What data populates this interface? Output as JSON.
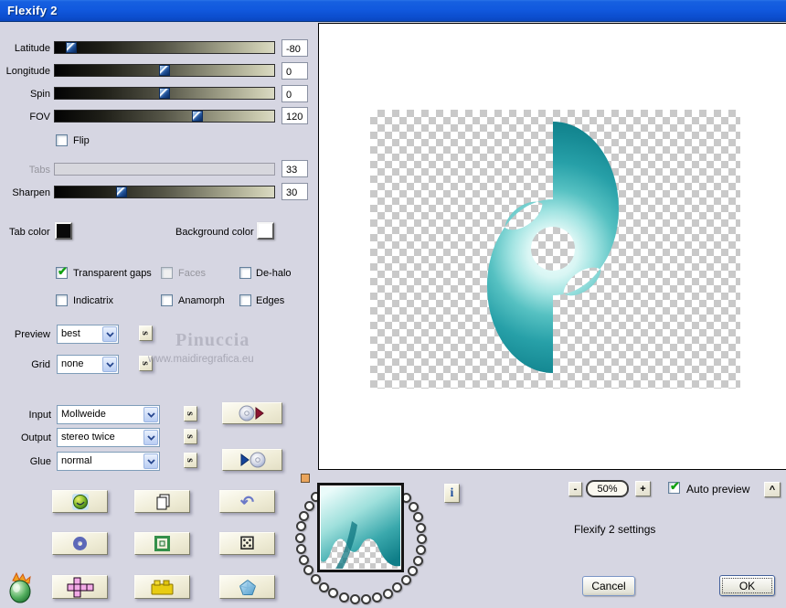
{
  "window": {
    "title": "Flexify 2"
  },
  "colors": {
    "titlebar_blue": "#1159de",
    "dialog_bg": "#d6d6e2",
    "button_beige": "#efecd6",
    "teal_dark": "#107e88",
    "teal_light": "#eafbfa",
    "check_green": "#12a112",
    "tab_color_swatch": "#0a0a0a",
    "background_color_swatch": "#ffffff"
  },
  "sliders": [
    {
      "label": "Latitude",
      "value": "-80",
      "percent": 7.6,
      "disabled": false
    },
    {
      "label": "Longitude",
      "value": "0",
      "percent": 49.8,
      "disabled": false
    },
    {
      "label": "Spin",
      "value": "0",
      "percent": 49.8,
      "disabled": false
    },
    {
      "label": "FOV",
      "value": "120",
      "percent": 65.1,
      "disabled": false
    },
    {
      "label": "Tabs",
      "value": "33",
      "percent": null,
      "disabled": true
    },
    {
      "label": "Sharpen",
      "value": "30",
      "percent": 30.6,
      "disabled": false
    }
  ],
  "flip": {
    "label": "Flip",
    "checked": false
  },
  "color_row": {
    "tab_color_label": "Tab color",
    "background_color_label": "Background color"
  },
  "option_checkboxes": [
    {
      "label": "Transparent gaps",
      "checked": true,
      "disabled": false
    },
    {
      "label": "Faces",
      "checked": false,
      "disabled": true
    },
    {
      "label": "De-halo",
      "checked": false,
      "disabled": false
    },
    {
      "label": "Indicatrix",
      "checked": false,
      "disabled": false
    },
    {
      "label": "Anamorph",
      "checked": false,
      "disabled": false
    },
    {
      "label": "Edges",
      "checked": false,
      "disabled": false
    }
  ],
  "selects": {
    "preview": {
      "label": "Preview",
      "value": "best"
    },
    "grid": {
      "label": "Grid",
      "value": "none"
    },
    "input": {
      "label": "Input",
      "value": "Mollweide"
    },
    "output": {
      "label": "Output",
      "value": "stereo twice"
    },
    "glue": {
      "label": "Glue",
      "value": "normal"
    }
  },
  "s_button_label": "s",
  "watermark": {
    "line1": "Pinuccia",
    "line2": "www.maidiregrafica.eu"
  },
  "footer": {
    "info_label": "i",
    "zoom_out": "-",
    "zoom_level": "50%",
    "zoom_in": "+",
    "auto_preview_label": "Auto preview",
    "auto_preview_checked": true,
    "collapse_label": "^",
    "settings_text": "Flexify 2 settings",
    "cancel_label": "Cancel",
    "ok_label": "OK"
  },
  "glyphs": {
    "check": "✔",
    "undo": "↶",
    "dice": "⚄"
  }
}
